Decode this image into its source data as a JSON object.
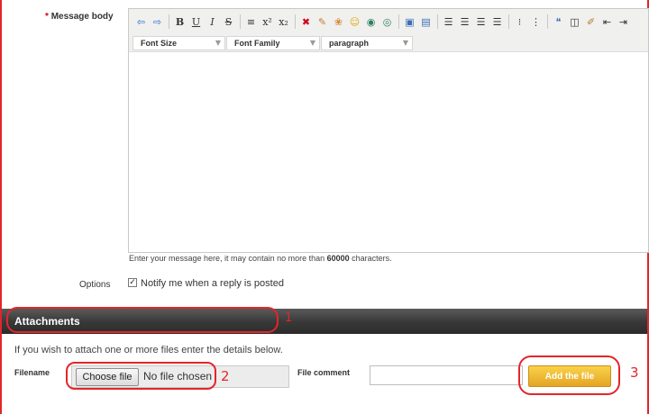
{
  "message": {
    "required_mark": "*",
    "label": "Message body",
    "hint_prefix": "Enter your message here, it may contain no more than ",
    "hint_limit": "60000",
    "hint_suffix": " characters."
  },
  "editor": {
    "toolbar_icons": [
      "arrow-left-icon",
      "arrow-right-icon",
      "bold-icon",
      "underline-icon",
      "italic-icon",
      "strikethrough-icon",
      "horizontal-rule-icon",
      "superscript-icon",
      "subscript-icon",
      "remove-format-icon",
      "text-color-icon",
      "background-color-icon",
      "emoticon-icon",
      "globe-link-icon",
      "unlink-icon",
      "insert-image-icon",
      "insert-media-icon",
      "align-left-icon",
      "align-center-icon",
      "align-right-icon",
      "align-justify-icon",
      "unordered-list-icon",
      "ordered-list-icon",
      "quote-icon",
      "code-icon",
      "paint-icon",
      "outdent-icon",
      "indent-icon"
    ],
    "font_size": "Font Size",
    "font_family": "Font Family",
    "format": "paragraph"
  },
  "options": {
    "label": "Options",
    "notify_label": "Notify me when a reply is posted",
    "notify_checked": true
  },
  "attachments": {
    "title": "Attachments",
    "description": "If you wish to attach one or more files enter the details below.",
    "filename_label": "Filename",
    "choose_button": "Choose file",
    "no_file": "No file chosen",
    "comment_label": "File comment",
    "comment_value": "",
    "add_button": "Add the file"
  },
  "annotations": {
    "n1": "1",
    "n2": "2",
    "n3": "3",
    "color": "#e2262a"
  }
}
